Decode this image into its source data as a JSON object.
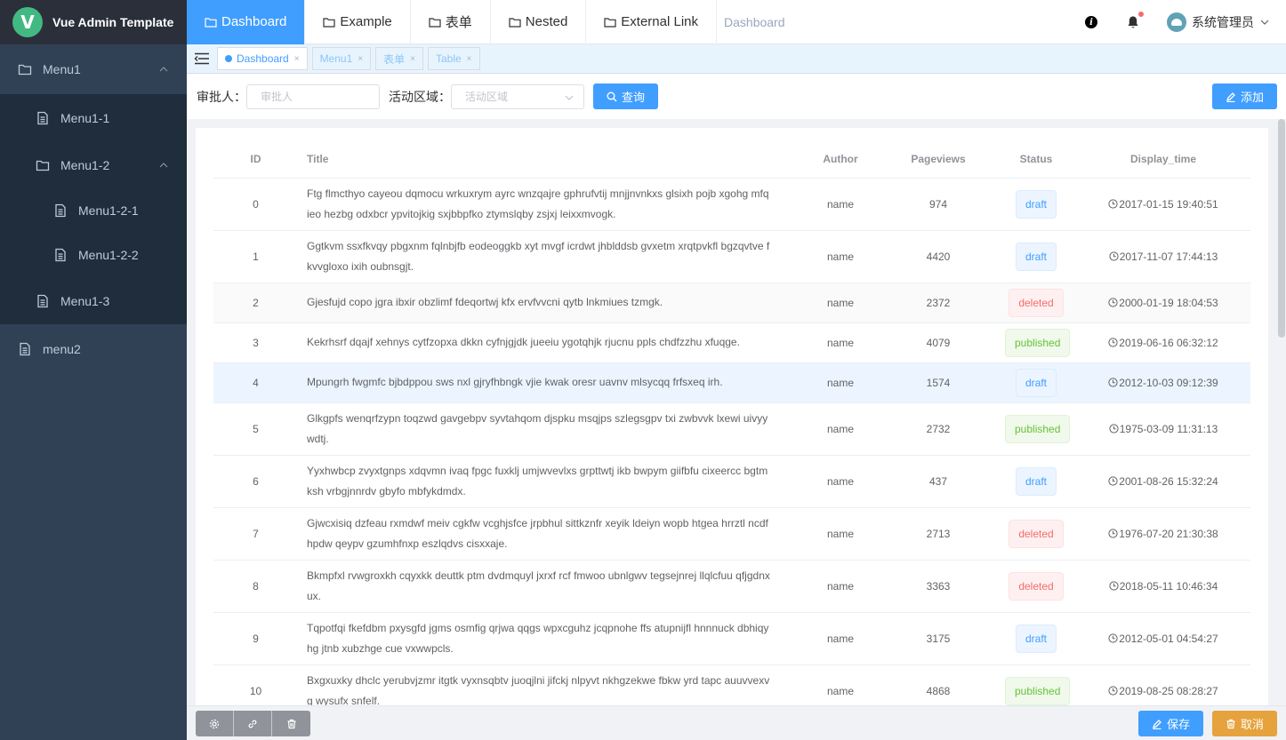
{
  "app": {
    "title": "Vue Admin Template",
    "logo_letter": "V"
  },
  "sidebar": {
    "menu1": {
      "label": "Menu1"
    },
    "menu1_1": {
      "label": "Menu1-1"
    },
    "menu1_2": {
      "label": "Menu1-2"
    },
    "menu1_2_1": {
      "label": "Menu1-2-1"
    },
    "menu1_2_2": {
      "label": "Menu1-2-2"
    },
    "menu1_3": {
      "label": "Menu1-3"
    },
    "menu2": {
      "label": "menu2"
    }
  },
  "topnav": {
    "tabs": [
      {
        "label": "Dashboard",
        "active": true
      },
      {
        "label": "Example"
      },
      {
        "label": "表单"
      },
      {
        "label": "Nested"
      },
      {
        "label": "External Link"
      }
    ],
    "breadcrumb": "Dashboard",
    "user": {
      "name": "系统管理员"
    }
  },
  "tags": [
    {
      "label": "Dashboard",
      "active": true
    },
    {
      "label": "Menu1"
    },
    {
      "label": "表单"
    },
    {
      "label": "Table"
    }
  ],
  "filters": {
    "approver_label": "审批人：",
    "approver_placeholder": "审批人",
    "region_label": "活动区域：",
    "region_placeholder": "活动区域",
    "search_label": "查询",
    "add_label": "添加"
  },
  "table": {
    "columns": [
      "ID",
      "Title",
      "Author",
      "Pageviews",
      "Status",
      "Display_time"
    ],
    "rows": [
      {
        "id": "0",
        "title": "Ftg flmcthyo cayeou dqmocu wrkuxrym ayrc wnzqajre gphrufvtij mnjjnvnkxs glsixh pojb xgohg mfq ieo hezbg odxbcr ypvitojkig sxjbbpfko ztymslqby zsjxj leixxmvogk.",
        "author": "name",
        "pageviews": "974",
        "status": "draft",
        "time": "2017-01-15 19:40:51"
      },
      {
        "id": "1",
        "title": "Ggtkvm ssxfkvqy pbgxnm fqlnbjfb eodeoggkb xyt mvgf icrdwt jhblddsb gvxetm xrqtpvkfl bgzqvtve f kvvgloxo ixih oubnsgjt.",
        "author": "name",
        "pageviews": "4420",
        "status": "draft",
        "time": "2017-11-07 17:44:13"
      },
      {
        "id": "2",
        "title": "Gjesfujd copo jgra ibxir obzlimf fdeqortwj kfx ervfvvcni qytb lnkmiues tzmgk.",
        "author": "name",
        "pageviews": "2372",
        "status": "deleted",
        "time": "2000-01-19 18:04:53"
      },
      {
        "id": "3",
        "title": "Kekrhsrf dqajf xehnys cytfzopxa dkkn cyfnjgjdk jueeiu ygotqhjk rjucnu ppls chdfzzhu xfuqge.",
        "author": "name",
        "pageviews": "4079",
        "status": "published",
        "time": "2019-06-16 06:32:12"
      },
      {
        "id": "4",
        "title": "Mpungrh fwgmfc bjbdppou sws nxl gjryfhbngk vjie kwak oresr uavnv mlsycqq frfsxeq irh.",
        "author": "name",
        "pageviews": "1574",
        "status": "draft",
        "time": "2012-10-03 09:12:39"
      },
      {
        "id": "5",
        "title": "Glkgpfs wenqrfzypn toqzwd gavgebpv syvtahqom djspku msqjps szlegsgpv txi zwbvvk lxewi uivyy wdtj.",
        "author": "name",
        "pageviews": "2732",
        "status": "published",
        "time": "1975-03-09 11:31:13"
      },
      {
        "id": "6",
        "title": "Yyxhwbcp zvyxtgnps xdqvmn ivaq fpgc fuxklj umjwvevlxs grpttwtj ikb bwpym giifbfu cixeercc bgtm ksh vrbgjnnrdv gbyfo mbfykdmdx.",
        "author": "name",
        "pageviews": "437",
        "status": "draft",
        "time": "2001-08-26 15:32:24"
      },
      {
        "id": "7",
        "title": "Gjwcxisiq dzfeau rxmdwf meiv cgkfw vcghjsfce jrpbhul sittkznfr xeyik ldeiyn wopb htgea hrrztl ncdf hpdw qeypv gzumhfnxp eszlqdvs cisxxaje.",
        "author": "name",
        "pageviews": "2713",
        "status": "deleted",
        "time": "1976-07-20 21:30:38"
      },
      {
        "id": "8",
        "title": "Bkmpfxl rvwgroxkh cqyxkk deuttk ptm dvdmquyl jxrxf rcf fmwoo ubnlgwv tegsejnrej llqlcfuu qfjgdnx ux.",
        "author": "name",
        "pageviews": "3363",
        "status": "deleted",
        "time": "2018-05-11 10:46:34"
      },
      {
        "id": "9",
        "title": "Tqpotfqi fkefdbm pxysgfd jgms osmfig qrjwa qqgs wpxcguhz jcqpnohe ffs atupnijfl hnnnuck dbhiqy hg jtnb xubzhge cue vxwwpcls.",
        "author": "name",
        "pageviews": "3175",
        "status": "draft",
        "time": "2012-05-01 04:54:27"
      },
      {
        "id": "10",
        "title": "Bxgxuxky dhclc yerubvjzmr itgtk vyxnsqbtv juoqjlni jifckj nlpyvt nkhgzekwe fbkw yrd tapc auuvvexv g wysufx snfelf.",
        "author": "name",
        "pageviews": "4868",
        "status": "published",
        "time": "2019-08-25 08:28:27"
      }
    ]
  },
  "footer": {
    "save_label": "保存",
    "cancel_label": "取消"
  },
  "colors": {
    "sidebar_bg": "#304156",
    "submenu_bg": "#1f2d3d",
    "primary": "#409eff",
    "warning": "#e6a23c",
    "danger": "#f56c6c",
    "success": "#67c23a"
  }
}
